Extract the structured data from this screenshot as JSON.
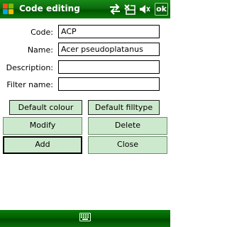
{
  "window": {
    "title": "Code editing",
    "ok_label": "ok"
  },
  "status_icons": [
    "connectivity-icon",
    "signal-off-icon",
    "volume-icon"
  ],
  "form": {
    "code_label": "Code:",
    "code_value": "ACP",
    "name_label": "Name:",
    "name_value": "Acer pseudoplatanus",
    "description_label": "Description:",
    "description_value": "",
    "filter_name_label": "Filter name:",
    "filter_name_value": ""
  },
  "buttons": {
    "default_colour": "Default colour",
    "default_filltype": "Default filltype",
    "modify": "Modify",
    "delete": "Delete",
    "add": "Add",
    "close": "Close"
  },
  "colors": {
    "titlebar": "#0e6a0e",
    "button_fill": "#cde9cd"
  }
}
